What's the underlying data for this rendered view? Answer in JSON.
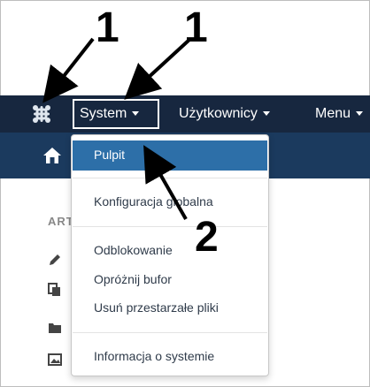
{
  "nav": {
    "items": [
      {
        "label": "System"
      },
      {
        "label": "Użytkownicy"
      },
      {
        "label": "Menu"
      }
    ]
  },
  "sidebar": {
    "heading": "ART"
  },
  "dropdown": {
    "items": [
      {
        "label": "Pulpit",
        "active": true
      },
      {
        "label": "Konfiguracja globalna"
      },
      {
        "label": "Odblokowanie"
      },
      {
        "label": "Opróżnij bufor"
      },
      {
        "label": "Usuń przestarzałe pliki"
      },
      {
        "label": "Informacja o systemie"
      }
    ]
  },
  "annotations": {
    "label_1a": "1",
    "label_1b": "1",
    "label_2": "2"
  },
  "colors": {
    "topbar": "#17273f",
    "subbar": "#1b3a5e",
    "active_item": "#2d6fa8"
  }
}
